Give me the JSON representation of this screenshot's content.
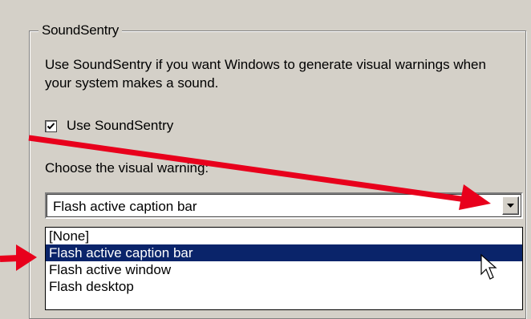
{
  "group": {
    "title": "SoundSentry",
    "description": "Use SoundSentry if you want Windows to generate visual warnings when your system makes a sound."
  },
  "checkbox": {
    "label": "Use SoundSentry",
    "checked": true
  },
  "choose_label": "Choose the visual warning:",
  "combo": {
    "value": "Flash active caption bar",
    "options": [
      "[None]",
      "Flash active caption bar",
      "Flash active window",
      "Flash desktop"
    ],
    "selected_index": 1
  },
  "icons": {
    "check": "checkmark-icon",
    "dropdown": "chevron-down-icon",
    "cursor": "mouse-pointer-icon",
    "annotation_arrows": "red-arrow-icon"
  },
  "colors": {
    "window_bg": "#d4d0c8",
    "selection_bg": "#0a246a",
    "annotation": "#e8001c"
  }
}
